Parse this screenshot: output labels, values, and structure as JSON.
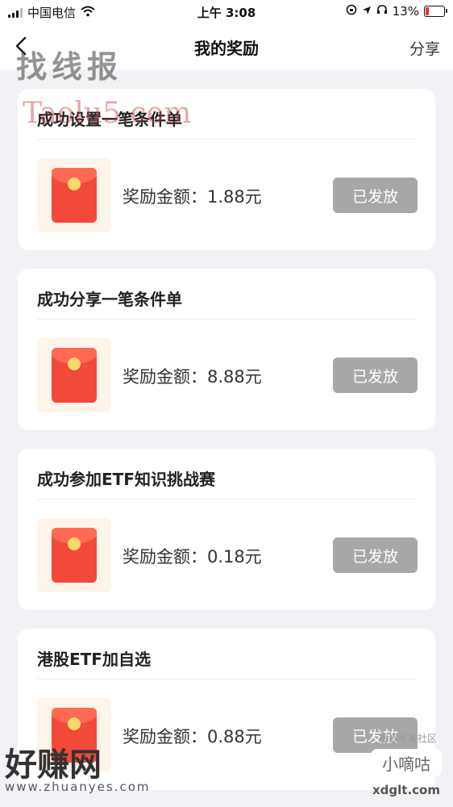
{
  "status_bar": {
    "carrier": "中国电信",
    "time": "上午 3:08",
    "battery": "13%"
  },
  "header": {
    "title": "我的奖励",
    "share_label": "分享"
  },
  "rewards": [
    {
      "title": "成功设置一笔条件单",
      "amount_label": "奖励金额：",
      "amount": "1.88元",
      "status": "已发放"
    },
    {
      "title": "成功分享一笔条件单",
      "amount_label": "奖励金额：",
      "amount": "8.88元",
      "status": "已发放"
    },
    {
      "title": "成功参加ETF知识挑战赛",
      "amount_label": "奖励金额：",
      "amount": "0.18元",
      "status": "已发放"
    },
    {
      "title": "港股ETF加自选",
      "amount_label": "奖励金额：",
      "amount": "0.88元",
      "status": "已发放"
    }
  ],
  "watermarks": {
    "top_left_cn": "找线报",
    "top_left_en": "Taolu5.com",
    "bottom_left_cn": "好赚网",
    "bottom_left_url": "www.zhuanyes.com",
    "bottom_right_small": "搜狐号发社区",
    "bottom_right_logo": "小嘀咕",
    "bottom_right_url": "xdglt.com"
  },
  "colors": {
    "page_bg": "#f2f2f6",
    "card_bg": "#ffffff",
    "status_button_bg": "#a7a7a7",
    "envelope_red": "#f24a3a",
    "envelope_bg": "#fdf4ea"
  },
  "icons": {
    "back": "chevron-left-icon",
    "wifi": "wifi-icon",
    "location": "location-arrow-icon",
    "headphones": "headphones-icon",
    "lock_rotation": "rotation-lock-icon",
    "battery": "battery-icon",
    "envelope": "red-envelope-icon"
  }
}
